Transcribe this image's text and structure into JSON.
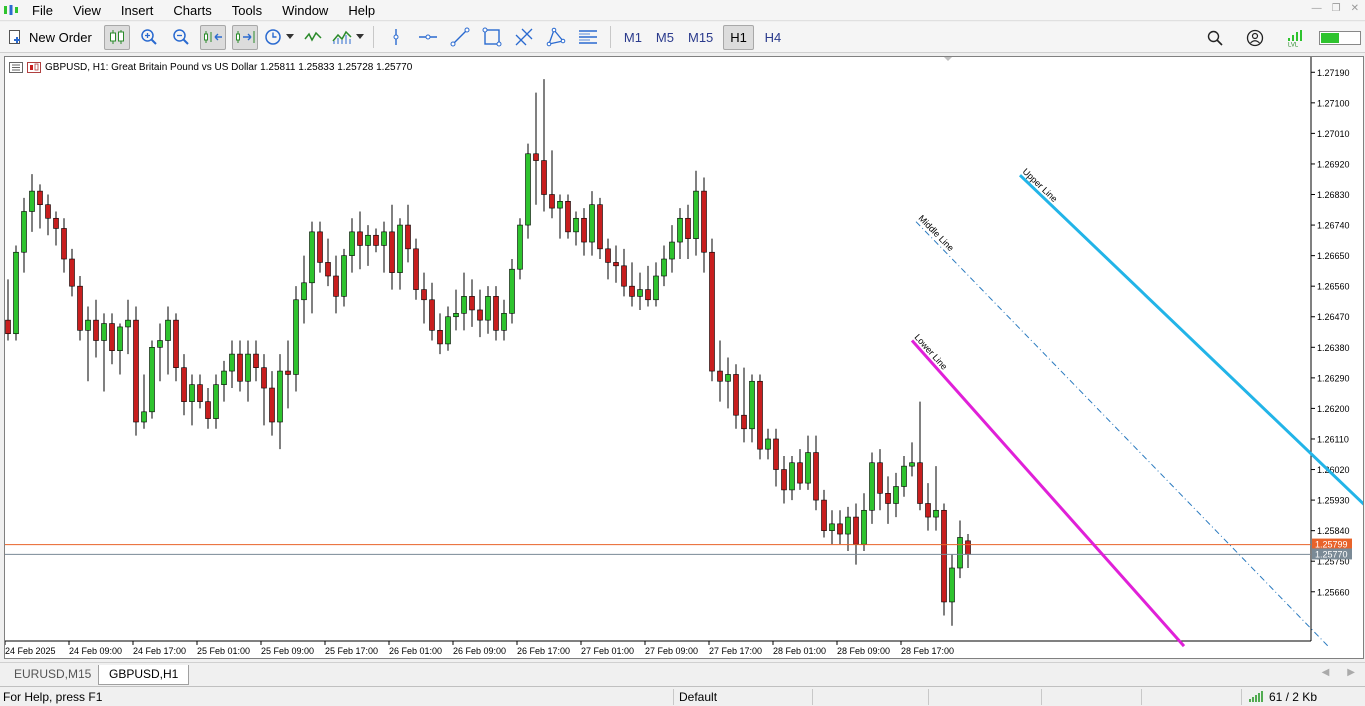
{
  "menu": [
    "File",
    "View",
    "Insert",
    "Charts",
    "Tools",
    "Window",
    "Help"
  ],
  "toolbar": {
    "new_order_label": "New Order",
    "timeframes": [
      "M1",
      "M5",
      "M15",
      "H1",
      "H4"
    ],
    "active_timeframe": "H1"
  },
  "chart": {
    "header": "GBPUSD, H1:  Great Britain Pound vs US Dollar  1.25811 1.25833 1.25728 1.25770",
    "ask_price_label": "1.25799",
    "bid_price_label": "1.25770",
    "colors": {
      "bull": "#2ec32e",
      "bear": "#c81e1e",
      "upper_line": "#22b4e8",
      "lower_line": "#e020d8",
      "middle_line": "#2a7abf",
      "ask_line": "#e8632a",
      "bid_line": "#7a8a96"
    }
  },
  "chart_data": {
    "type": "candlestick",
    "symbol": "GBPUSD",
    "timeframe": "H1",
    "ylim": [
      1.25515,
      1.27235
    ],
    "y_ticks": [
      "1.27190",
      "1.27100",
      "1.27010",
      "1.26920",
      "1.26830",
      "1.26740",
      "1.26650",
      "1.26560",
      "1.26470",
      "1.26380",
      "1.26290",
      "1.26200",
      "1.26110",
      "1.26020",
      "1.25930",
      "1.25840",
      "1.25750",
      "1.25660"
    ],
    "x_ticks": [
      "24 Feb 2025",
      "24 Feb 09:00",
      "24 Feb 17:00",
      "25 Feb 01:00",
      "25 Feb 09:00",
      "25 Feb 17:00",
      "26 Feb 01:00",
      "26 Feb 09:00",
      "26 Feb 17:00",
      "27 Feb 01:00",
      "27 Feb 09:00",
      "27 Feb 17:00",
      "28 Feb 01:00",
      "28 Feb 09:00",
      "28 Feb 17:00"
    ],
    "candles": [
      [
        1.2646,
        1.2658,
        1.264,
        1.2642
      ],
      [
        1.2642,
        1.2668,
        1.264,
        1.2666
      ],
      [
        1.2666,
        1.2682,
        1.266,
        1.2678
      ],
      [
        1.2678,
        1.2689,
        1.2672,
        1.2684
      ],
      [
        1.2684,
        1.2686,
        1.2673,
        1.268
      ],
      [
        1.268,
        1.2683,
        1.2671,
        1.2676
      ],
      [
        1.2676,
        1.2678,
        1.2668,
        1.2673
      ],
      [
        1.2673,
        1.2676,
        1.266,
        1.2664
      ],
      [
        1.2664,
        1.2667,
        1.2653,
        1.2656
      ],
      [
        1.2656,
        1.2659,
        1.264,
        1.2643
      ],
      [
        1.2643,
        1.265,
        1.2628,
        1.2646
      ],
      [
        1.2646,
        1.2652,
        1.2635,
        1.264
      ],
      [
        1.264,
        1.2648,
        1.2625,
        1.2645
      ],
      [
        1.2645,
        1.2648,
        1.2633,
        1.2637
      ],
      [
        1.2637,
        1.2645,
        1.263,
        1.2644
      ],
      [
        1.2644,
        1.2652,
        1.2636,
        1.2646
      ],
      [
        1.2646,
        1.265,
        1.2612,
        1.2616
      ],
      [
        1.2616,
        1.263,
        1.2614,
        1.2619
      ],
      [
        1.2619,
        1.264,
        1.2617,
        1.2638
      ],
      [
        1.2638,
        1.2645,
        1.2628,
        1.264
      ],
      [
        1.264,
        1.265,
        1.263,
        1.2646
      ],
      [
        1.2646,
        1.2648,
        1.2628,
        1.2632
      ],
      [
        1.2632,
        1.2636,
        1.2618,
        1.2622
      ],
      [
        1.2622,
        1.263,
        1.2615,
        1.2627
      ],
      [
        1.2627,
        1.263,
        1.262,
        1.2622
      ],
      [
        1.2622,
        1.2626,
        1.2614,
        1.2617
      ],
      [
        1.2617,
        1.263,
        1.2614,
        1.2627
      ],
      [
        1.2627,
        1.2634,
        1.2622,
        1.2631
      ],
      [
        1.2631,
        1.264,
        1.2626,
        1.2636
      ],
      [
        1.2636,
        1.264,
        1.2625,
        1.2628
      ],
      [
        1.2628,
        1.264,
        1.2622,
        1.2636
      ],
      [
        1.2636,
        1.264,
        1.2628,
        1.2632
      ],
      [
        1.2632,
        1.2636,
        1.2615,
        1.2626
      ],
      [
        1.2626,
        1.2631,
        1.2612,
        1.2616
      ],
      [
        1.2616,
        1.2636,
        1.2608,
        1.2631
      ],
      [
        1.2631,
        1.264,
        1.262,
        1.263
      ],
      [
        1.263,
        1.2656,
        1.2625,
        1.2652
      ],
      [
        1.2652,
        1.2665,
        1.2645,
        1.2657
      ],
      [
        1.2657,
        1.2675,
        1.2648,
        1.2672
      ],
      [
        1.2672,
        1.2675,
        1.266,
        1.2663
      ],
      [
        1.2663,
        1.267,
        1.2656,
        1.2659
      ],
      [
        1.2659,
        1.2665,
        1.2648,
        1.2653
      ],
      [
        1.2653,
        1.2667,
        1.265,
        1.2665
      ],
      [
        1.2665,
        1.2676,
        1.266,
        1.2672
      ],
      [
        1.2672,
        1.2678,
        1.2661,
        1.2668
      ],
      [
        1.2668,
        1.2674,
        1.2662,
        1.2671
      ],
      [
        1.2671,
        1.2673,
        1.2666,
        1.2668
      ],
      [
        1.2668,
        1.2675,
        1.266,
        1.2672
      ],
      [
        1.2672,
        1.268,
        1.2655,
        1.266
      ],
      [
        1.266,
        1.2676,
        1.2655,
        1.2674
      ],
      [
        1.2674,
        1.268,
        1.2663,
        1.2667
      ],
      [
        1.2667,
        1.267,
        1.2652,
        1.2655
      ],
      [
        1.2655,
        1.266,
        1.2645,
        1.2652
      ],
      [
        1.2652,
        1.2657,
        1.264,
        1.2643
      ],
      [
        1.2643,
        1.2648,
        1.2636,
        1.2639
      ],
      [
        1.2639,
        1.265,
        1.2637,
        1.2647
      ],
      [
        1.2647,
        1.2655,
        1.2643,
        1.2648
      ],
      [
        1.2648,
        1.266,
        1.2643,
        1.2653
      ],
      [
        1.2653,
        1.2658,
        1.2644,
        1.2649
      ],
      [
        1.2649,
        1.2655,
        1.2641,
        1.2646
      ],
      [
        1.2646,
        1.2656,
        1.2642,
        1.2653
      ],
      [
        1.2653,
        1.2656,
        1.264,
        1.2643
      ],
      [
        1.2643,
        1.2652,
        1.264,
        1.2648
      ],
      [
        1.2648,
        1.2664,
        1.2645,
        1.2661
      ],
      [
        1.2661,
        1.2676,
        1.2658,
        1.2674
      ],
      [
        1.2674,
        1.2698,
        1.267,
        1.2695
      ],
      [
        1.2695,
        1.2713,
        1.268,
        1.2693
      ],
      [
        1.2693,
        1.2717,
        1.2678,
        1.2683
      ],
      [
        1.2683,
        1.2696,
        1.2676,
        1.2679
      ],
      [
        1.2679,
        1.2683,
        1.267,
        1.2681
      ],
      [
        1.2681,
        1.2683,
        1.267,
        1.2672
      ],
      [
        1.2672,
        1.2678,
        1.2668,
        1.2676
      ],
      [
        1.2676,
        1.2679,
        1.2665,
        1.2669
      ],
      [
        1.2669,
        1.2684,
        1.2665,
        1.268
      ],
      [
        1.268,
        1.2682,
        1.2664,
        1.2667
      ],
      [
        1.2667,
        1.267,
        1.2658,
        1.2663
      ],
      [
        1.2663,
        1.2668,
        1.2657,
        1.2662
      ],
      [
        1.2662,
        1.2667,
        1.2653,
        1.2656
      ],
      [
        1.2656,
        1.2663,
        1.265,
        1.2653
      ],
      [
        1.2653,
        1.266,
        1.2649,
        1.2655
      ],
      [
        1.2655,
        1.2662,
        1.265,
        1.2652
      ],
      [
        1.2652,
        1.2663,
        1.265,
        1.2659
      ],
      [
        1.2659,
        1.2668,
        1.2656,
        1.2664
      ],
      [
        1.2664,
        1.2674,
        1.266,
        1.2669
      ],
      [
        1.2669,
        1.2679,
        1.2664,
        1.2676
      ],
      [
        1.2676,
        1.268,
        1.2664,
        1.267
      ],
      [
        1.267,
        1.269,
        1.2665,
        1.2684
      ],
      [
        1.2684,
        1.2688,
        1.266,
        1.2666
      ],
      [
        1.2666,
        1.267,
        1.2628,
        1.2631
      ],
      [
        1.2631,
        1.264,
        1.2622,
        1.2628
      ],
      [
        1.2628,
        1.2635,
        1.262,
        1.263
      ],
      [
        1.263,
        1.2633,
        1.2614,
        1.2618
      ],
      [
        1.2618,
        1.2632,
        1.261,
        1.2614
      ],
      [
        1.2614,
        1.263,
        1.261,
        1.2628
      ],
      [
        1.2628,
        1.263,
        1.2605,
        1.2608
      ],
      [
        1.2608,
        1.2614,
        1.2605,
        1.2611
      ],
      [
        1.2611,
        1.2614,
        1.2597,
        1.2602
      ],
      [
        1.2602,
        1.2606,
        1.2592,
        1.2596
      ],
      [
        1.2596,
        1.2606,
        1.2593,
        1.2604
      ],
      [
        1.2604,
        1.2608,
        1.2596,
        1.2598
      ],
      [
        1.2598,
        1.2612,
        1.2596,
        1.2607
      ],
      [
        1.2607,
        1.2612,
        1.259,
        1.2593
      ],
      [
        1.2593,
        1.2596,
        1.2582,
        1.2584
      ],
      [
        1.2584,
        1.259,
        1.258,
        1.2586
      ],
      [
        1.2586,
        1.259,
        1.258,
        1.2583
      ],
      [
        1.2583,
        1.2591,
        1.2578,
        1.2588
      ],
      [
        1.2588,
        1.2592,
        1.2574,
        1.258
      ],
      [
        1.258,
        1.2595,
        1.2578,
        1.259
      ],
      [
        1.259,
        1.2607,
        1.2586,
        1.2604
      ],
      [
        1.2604,
        1.2608,
        1.259,
        1.2595
      ],
      [
        1.2595,
        1.26,
        1.2586,
        1.2592
      ],
      [
        1.2592,
        1.2601,
        1.2588,
        1.2597
      ],
      [
        1.2597,
        1.2606,
        1.2594,
        1.2603
      ],
      [
        1.2603,
        1.261,
        1.26,
        1.2604
      ],
      [
        1.2604,
        1.2622,
        1.259,
        1.2592
      ],
      [
        1.2592,
        1.2598,
        1.2584,
        1.2588
      ],
      [
        1.2588,
        1.2603,
        1.2584,
        1.259
      ],
      [
        1.259,
        1.2592,
        1.2559,
        1.2563
      ],
      [
        1.2563,
        1.2577,
        1.2556,
        1.2573
      ],
      [
        1.2573,
        1.2587,
        1.257,
        1.2582
      ],
      [
        1.2581,
        1.2583,
        1.2573,
        1.2577
      ]
    ],
    "lines": [
      {
        "name": "Upper Line",
        "from": {
          "bar": 126.5,
          "price": 1.26887
        },
        "to": {
          "bar": 188,
          "price": 1.255
        }
      },
      {
        "name": "Middle Line",
        "from": {
          "bar": 113.5,
          "price": 1.2675
        },
        "to": {
          "bar": 165,
          "price": 1.255
        }
      },
      {
        "name": "Lower Line",
        "from": {
          "bar": 113,
          "price": 1.264
        },
        "to": {
          "bar": 147,
          "price": 1.255
        }
      }
    ]
  },
  "tabs": [
    "EURUSD,M15",
    "GBPUSD,H1"
  ],
  "active_tab": "GBPUSD,H1",
  "status": {
    "help": "For Help, press F1",
    "profile": "Default",
    "traffic": "61 / 2 Kb"
  }
}
